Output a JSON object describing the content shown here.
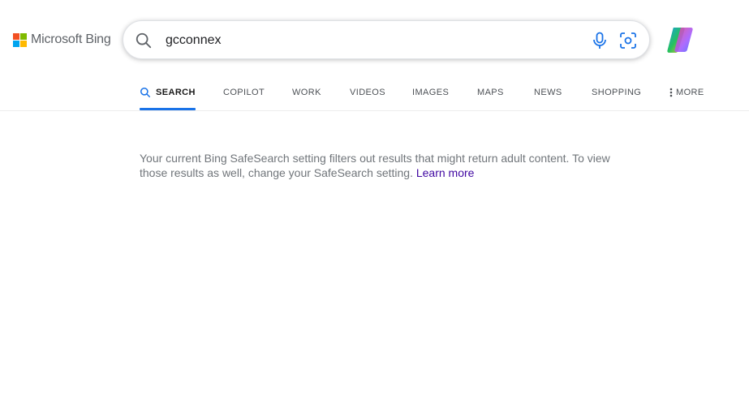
{
  "brand": {
    "logo_text": "Microsoft Bing",
    "colors": [
      "#f25022",
      "#7fba00",
      "#00a4ef",
      "#ffb900"
    ]
  },
  "search": {
    "query": "gcconnex"
  },
  "tabs": [
    {
      "label": "SEARCH",
      "active": true
    },
    {
      "label": "COPILOT"
    },
    {
      "label": "WORK"
    },
    {
      "label": "VIDEOS"
    },
    {
      "label": "IMAGES"
    },
    {
      "label": "MAPS"
    },
    {
      "label": "NEWS"
    },
    {
      "label": "SHOPPING"
    },
    {
      "label": "MORE"
    }
  ],
  "notice": {
    "text": "Your current Bing SafeSearch setting filters out results that might return adult content. To view those results as well, change your SafeSearch setting.",
    "link_text": "Learn more"
  },
  "icons": [
    "search-icon",
    "microphone-icon",
    "visual-search-icon",
    "copilot-icon",
    "more-dots-icon"
  ],
  "accent_color": "#1a73e8"
}
